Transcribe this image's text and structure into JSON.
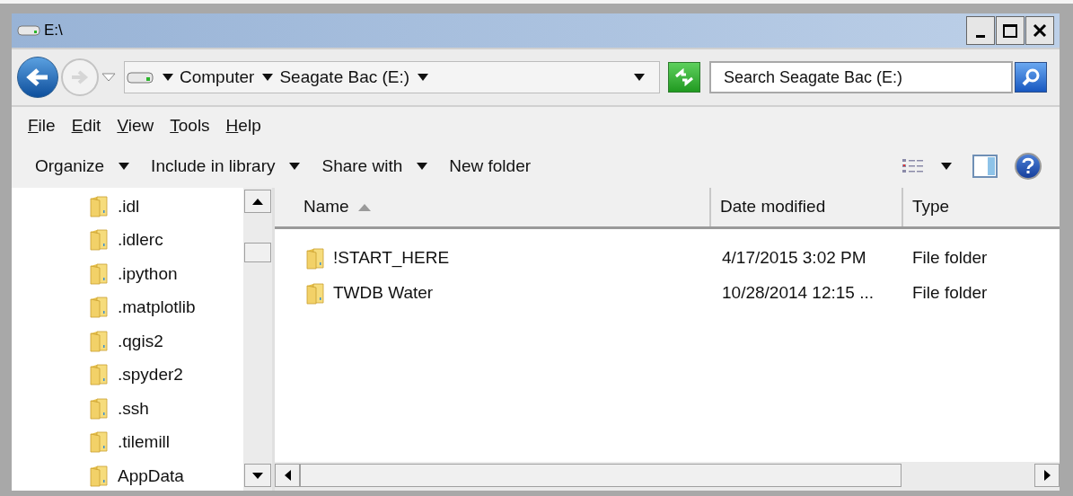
{
  "window": {
    "title": "E:\\"
  },
  "address_bar": {
    "breadcrumbs": [
      "Computer",
      "Seagate Bac (E:)"
    ]
  },
  "search": {
    "placeholder": "Search Seagate Bac (E:)"
  },
  "menu": [
    "File",
    "Edit",
    "View",
    "Tools",
    "Help"
  ],
  "toolbar": [
    {
      "label": "Organize",
      "has_menu": true
    },
    {
      "label": "Include in library",
      "has_menu": true
    },
    {
      "label": "Share with",
      "has_menu": true
    },
    {
      "label": "New folder",
      "has_menu": false
    }
  ],
  "navigation_pane": {
    "items": [
      ".idl",
      ".idlerc",
      ".ipython",
      ".matplotlib",
      ".qgis2",
      ".spyder2",
      ".ssh",
      ".tilemill",
      "AppData"
    ]
  },
  "file_list": {
    "columns": [
      {
        "label": "Name",
        "sorted": true
      },
      {
        "label": "Date modified",
        "sorted": false
      },
      {
        "label": "Type",
        "sorted": false
      }
    ],
    "rows": [
      {
        "name": "!START_HERE",
        "date_modified": "4/17/2015 3:02 PM",
        "type": "File folder"
      },
      {
        "name": "TWDB Water",
        "date_modified": "10/28/2014 12:15 ...",
        "type": "File folder"
      }
    ]
  }
}
